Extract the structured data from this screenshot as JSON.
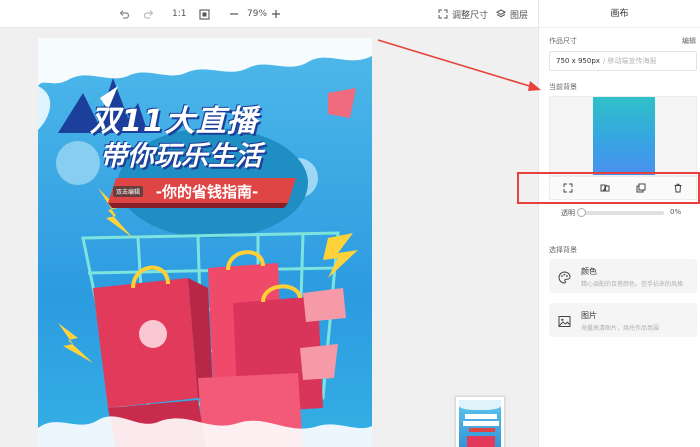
{
  "toolbar": {
    "zoom_ratio": "1:1",
    "zoom_level": "79%",
    "resize_label": "调整尺寸",
    "layers_label": "图层"
  },
  "canvas": {
    "hint_label": "双击编辑",
    "poster_text": {
      "line1": "双11大直播",
      "line2": "带你玩乐生活",
      "banner": "-你的省钱指南-"
    }
  },
  "panel": {
    "title": "画布",
    "size_section_label": "作品尺寸",
    "edit_label": "编辑",
    "size_value": "750 x 950px",
    "size_placeholder": "/ 移动端宣传海报",
    "current_bg_label": "当前背景",
    "opacity_label": "透明",
    "opacity_value": "0%",
    "choose_bg_label": "选择背景",
    "options": [
      {
        "title": "颜色",
        "desc": "精心调配的百搭颜色，信手拈来的风格"
      },
      {
        "title": "图片",
        "desc": "海量高清图片，烘托作品氛围"
      }
    ]
  },
  "colors": {
    "accent_red": "#e8403a",
    "poster_blue": "#2c9be0"
  }
}
